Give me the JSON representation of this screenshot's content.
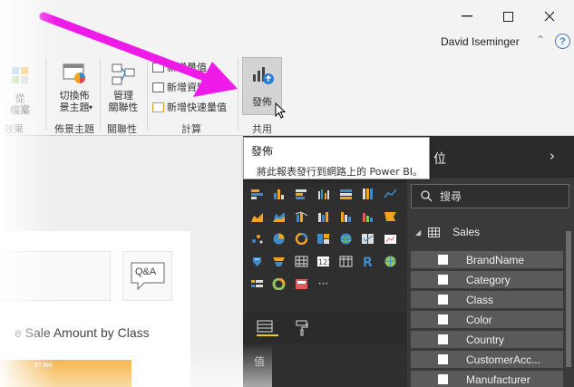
{
  "window": {
    "user": "David Iseminger",
    "help": "?"
  },
  "ribbon": {
    "partial_button": "從\n檔案",
    "partial_group": "效果",
    "switch_theme": "切換佈\n景主題",
    "theme_group": "佈景主題",
    "manage_rel": "管理\n關聯性",
    "rel_group": "關聯性",
    "small_buttons": [
      "新增量值",
      "新增資料行",
      "新增快速量值"
    ],
    "calc_group": "計算",
    "publish": "發佈",
    "share_group": "共用"
  },
  "tooltip": {
    "title": "發佈",
    "description": "將此報表發行到網路上的 Power BI。"
  },
  "canvas": {
    "qa_label": "Q&A",
    "chart_title": "e Sale Amount by Class",
    "bar_label": "$7.8M"
  },
  "viz": {
    "more": "···",
    "values_label": "值",
    "r_label": "R"
  },
  "fields": {
    "header_partial": "位",
    "search_placeholder": "搜尋",
    "table_name": "Sales",
    "items": [
      "BrandName",
      "Category",
      "Class",
      "Color",
      "Country",
      "CustomerAcc...",
      "Manufacturer"
    ]
  },
  "colors": {
    "arrow": "#ee1be8",
    "bar": "#f2a41f",
    "dark_panel": "#2f2f2f"
  }
}
